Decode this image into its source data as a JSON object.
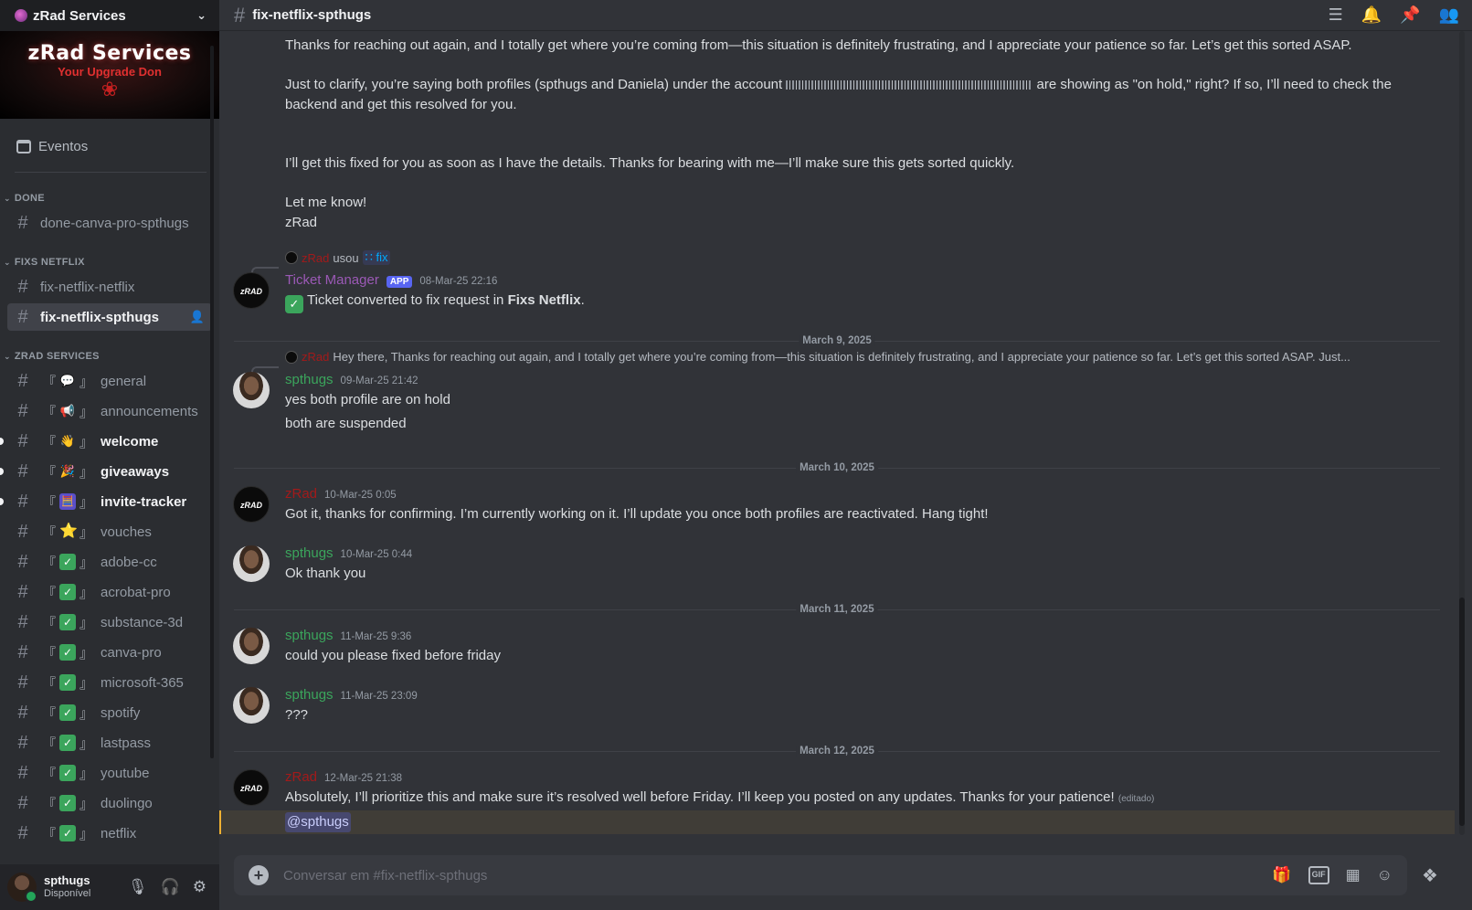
{
  "server": {
    "name": "zRad Services",
    "banner_title": "zRad Services",
    "banner_subtitle": "Your Upgrade Don"
  },
  "sidebar": {
    "events_label": "Eventos",
    "categories": [
      {
        "name": "DONE",
        "channels": [
          {
            "name": "done-canva-pro-spthugs",
            "emoji": "",
            "state": "normal"
          }
        ]
      },
      {
        "name": "FIXS NETFLIX",
        "channels": [
          {
            "name": "fix-netflix-netflix",
            "emoji": "",
            "state": "normal"
          },
          {
            "name": "fix-netflix-spthugs",
            "emoji": "",
            "state": "active"
          }
        ]
      },
      {
        "name": "ZRAD SERVICES",
        "channels": [
          {
            "name": "general",
            "emoji": "speech",
            "state": "normal"
          },
          {
            "name": "announcements",
            "emoji": "mega",
            "state": "normal"
          },
          {
            "name": "welcome",
            "emoji": "wave",
            "state": "unread"
          },
          {
            "name": "giveaways",
            "emoji": "party",
            "state": "unread"
          },
          {
            "name": "invite-tracker",
            "emoji": "abacus",
            "state": "unread"
          },
          {
            "name": "vouches",
            "emoji": "star",
            "state": "normal"
          },
          {
            "name": "adobe-cc",
            "emoji": "check",
            "state": "normal"
          },
          {
            "name": "acrobat-pro",
            "emoji": "check",
            "state": "normal"
          },
          {
            "name": "substance-3d",
            "emoji": "check",
            "state": "normal"
          },
          {
            "name": "canva-pro",
            "emoji": "check",
            "state": "normal"
          },
          {
            "name": "microsoft-365",
            "emoji": "check",
            "state": "normal"
          },
          {
            "name": "spotify",
            "emoji": "check",
            "state": "normal"
          },
          {
            "name": "lastpass",
            "emoji": "check",
            "state": "normal"
          },
          {
            "name": "youtube",
            "emoji": "check",
            "state": "normal"
          },
          {
            "name": "duolingo",
            "emoji": "check",
            "state": "normal"
          },
          {
            "name": "netflix",
            "emoji": "check",
            "state": "normal"
          }
        ]
      }
    ]
  },
  "user": {
    "name": "spthugs",
    "status": "Disponível"
  },
  "channel": {
    "name": "fix-netflix-spthugs"
  },
  "messages": {
    "p1": "Thanks for reaching out again, and I totally get where you’re coming from—this situation is definitely frustrating, and I appreciate your patience so far. Let’s get this sorted ASAP.",
    "p2a": "Just to clarify, you’re saying both profiles (spthugs and Daniela) under the account",
    "p2b": "are showing as \"on hold,\" right? If so, I’ll need to check the backend and get this resolved for you.",
    "p3": "I’ll get this fixed for you as soon as I have the details. Thanks for bearing with me—I’ll make sure this gets sorted quickly.",
    "p4": "Let me know!",
    "p5": "zRad",
    "tm_reply_user": "zRad",
    "tm_reply_used": "usou",
    "tm_reply_cmd": "fix",
    "tm_name": "Ticket Manager",
    "tm_tag": "APP",
    "tm_time": "08-Mar-25 22:16",
    "tm_text_a": "Ticket converted to fix request in",
    "tm_text_b": "Fixs Netflix",
    "tm_text_c": ".",
    "div1": "March 9, 2025",
    "s1_reply_user": "zRad",
    "s1_reply_text": "Hey there,    Thanks for reaching out again, and I totally get where you’re coming from—this situation is definitely frustrating, and I appreciate your patience so far. Let’s get this sorted ASAP.    Just...",
    "s1_name": "spthugs",
    "s1_time": "09-Mar-25 21:42",
    "s1_l1": "yes both profile are on hold",
    "s1_l2": "both are suspended",
    "div2": "March 10, 2025",
    "z1_name": "zRad",
    "z1_time": "10-Mar-25 0:05",
    "z1_text": "Got it, thanks for confirming. I’m currently working on it. I’ll update you once both profiles are reactivated. Hang tight!",
    "s2_name": "spthugs",
    "s2_time": "10-Mar-25 0:44",
    "s2_text": "Ok thank you",
    "div3": "March 11, 2025",
    "s3_name": "spthugs",
    "s3_time": "11-Mar-25 9:36",
    "s3_text": "could you please fixed before friday",
    "s4_name": "spthugs",
    "s4_time": "11-Mar-25 23:09",
    "s4_text": "???",
    "div4": "March 12, 2025",
    "z2_name": "zRad",
    "z2_time": "12-Mar-25 21:38",
    "z2_text": "Absolutely, I’ll prioritize this and make sure it’s resolved well before Friday. I’ll keep you posted on any updates. Thanks for your patience!",
    "z2_edited": "(editado)",
    "z2_mention": "@spthugs"
  },
  "composer": {
    "placeholder": "Conversar em #fix-netflix-spthugs",
    "gif_label": "GIF"
  },
  "colors": {
    "accent": "#5865f2",
    "online": "#23a55a",
    "spthugs_name": "#3ba55c",
    "zrad_name": "#a31a1a",
    "ticket_manager_name": "#9b59b6",
    "mention_highlight": "#f0b132"
  }
}
